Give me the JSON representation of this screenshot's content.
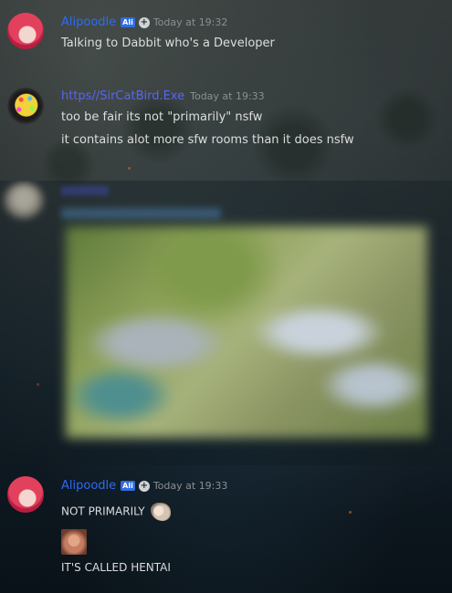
{
  "messages": [
    {
      "username": "Alipoodle",
      "badge": "Ali",
      "timestamp": "Today at 19:32",
      "lines": [
        "Talking to Dabbit who's a Developer"
      ]
    },
    {
      "username": "https//SirCatBird.Exe",
      "timestamp": "Today at 19:33",
      "lines": [
        "too be fair its not \"primarily\" nsfw",
        "it contains alot more sfw rooms than it does nsfw"
      ]
    },
    {
      "username": "Alipoodle",
      "badge": "Ali",
      "timestamp": "Today at 19:33",
      "lines": [
        "NOT PRIMARILY",
        "IT'S CALLED HENTAI"
      ]
    }
  ],
  "icons": {
    "verified": "plus-circle-icon",
    "blurred_content": "blurred-image-attachment"
  }
}
